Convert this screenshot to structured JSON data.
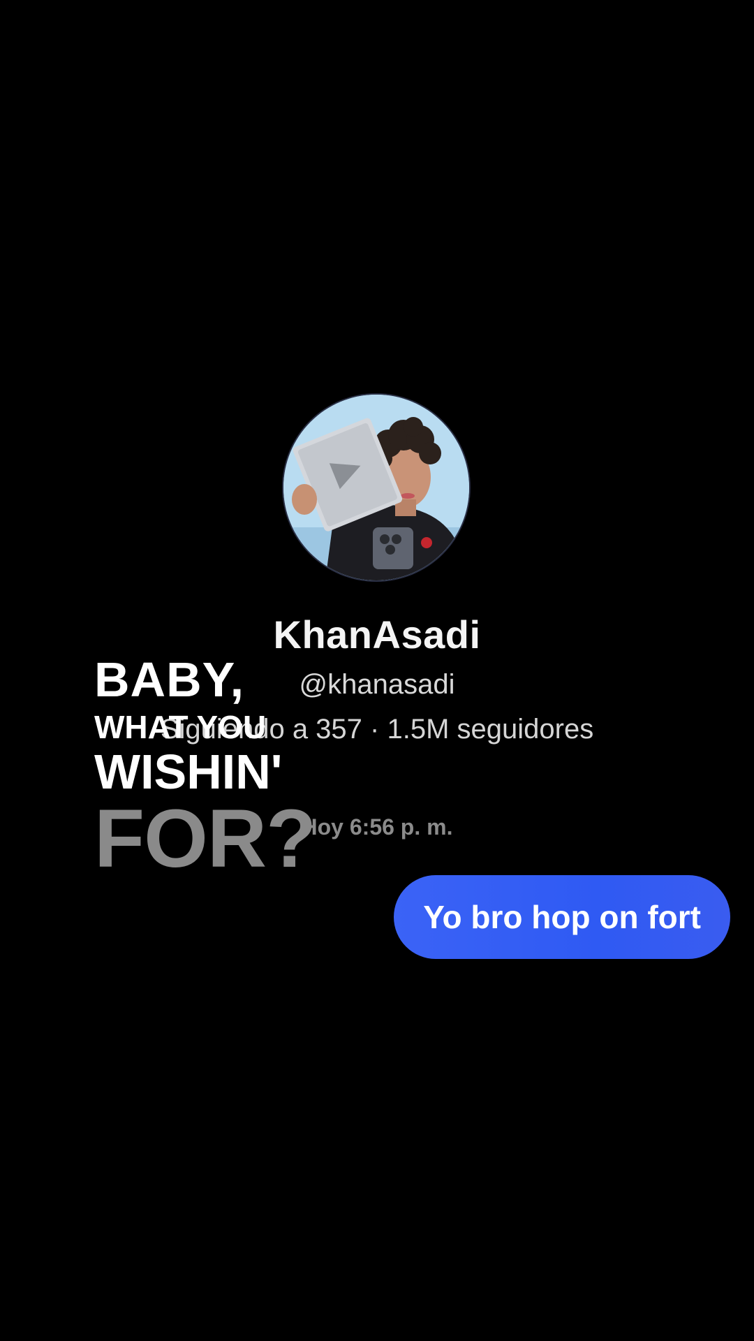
{
  "profile": {
    "avatar_icon": "profile-photo",
    "display_name": "KhanAsadi",
    "handle": "@khanasadi",
    "stats": "Siguiendo a 357 · 1.5M seguidores"
  },
  "conversation": {
    "timestamp": "Hoy 6:56 p. m.",
    "messages": [
      {
        "direction": "sent",
        "text": "Yo bro hop on fort"
      }
    ]
  },
  "overlay_caption": {
    "line1": "BABY,",
    "line2": "WHAT YOU",
    "line3": "WISHIN'",
    "line4": "FOR?"
  },
  "colors": {
    "background": "#000000",
    "bubble": "#3360f4",
    "caption_accent": "#8a8a8a"
  }
}
